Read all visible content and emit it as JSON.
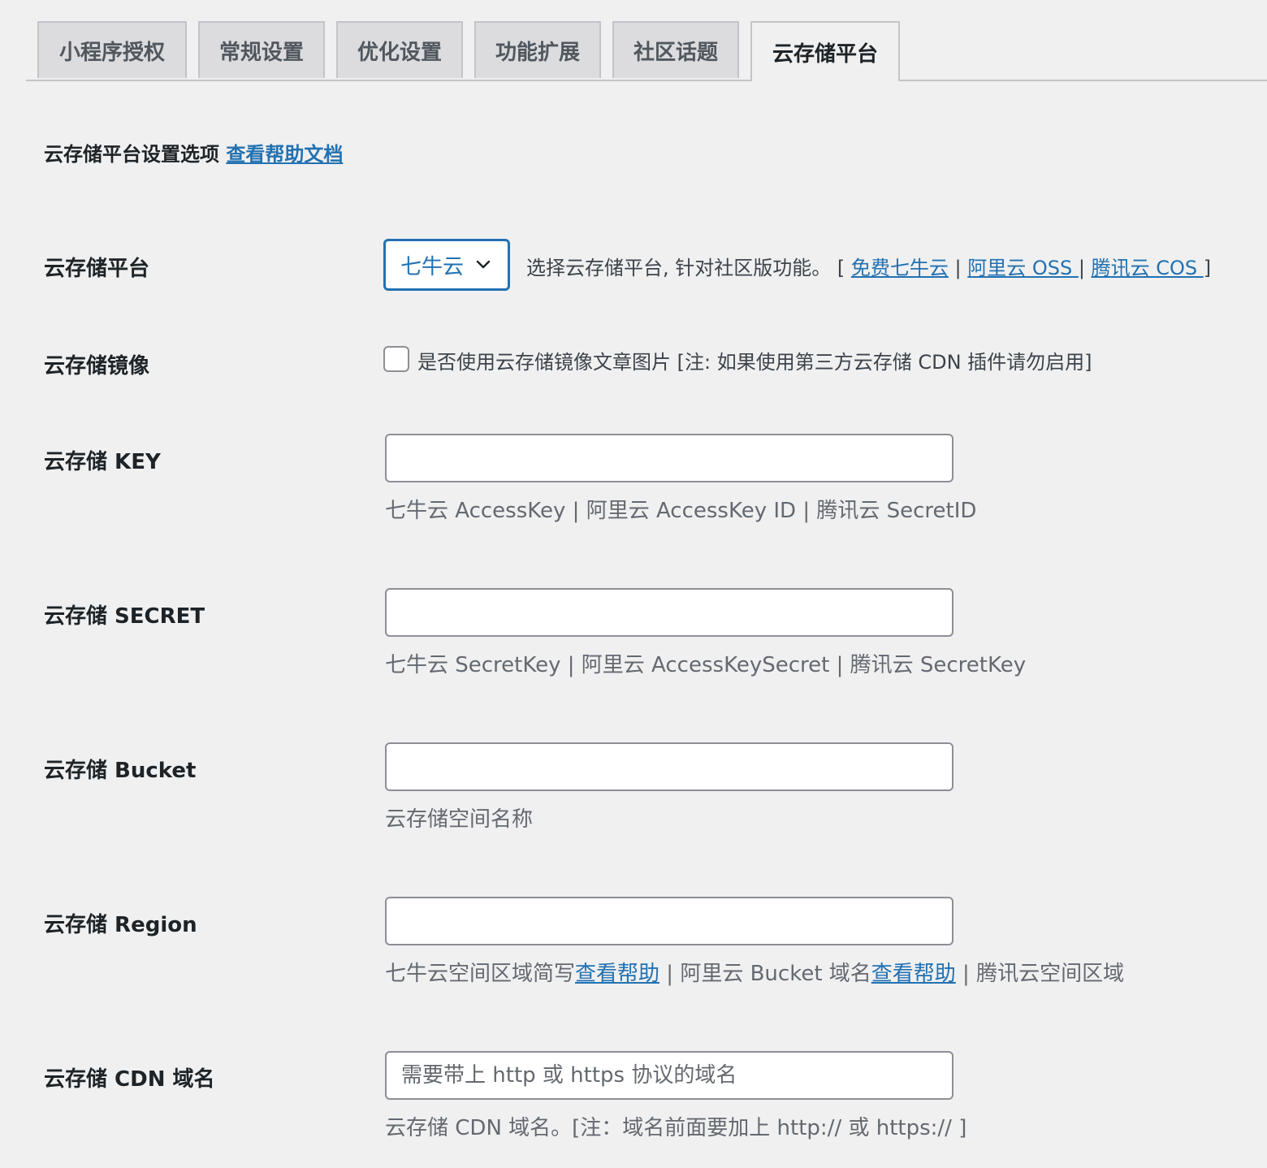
{
  "tabs": [
    {
      "label": "小程序授权"
    },
    {
      "label": "常规设置"
    },
    {
      "label": "优化设置"
    },
    {
      "label": "功能扩展"
    },
    {
      "label": "社区话题"
    },
    {
      "label": "云存储平台"
    }
  ],
  "section": {
    "title": "云存储平台设置选项",
    "help_link": "查看帮助文档"
  },
  "platform": {
    "label": "云存储平台",
    "selected": "七牛云",
    "desc_prefix": "选择云存储平台, 针对社区版功能。 [ ",
    "link_qiniu": "免费七牛云",
    "sep1": " | ",
    "link_aliyun": "阿里云 OSS ",
    "sep2": "| ",
    "link_tencent": "腾讯云 COS ",
    "desc_suffix": "]"
  },
  "mirror": {
    "label": "云存储镜像",
    "checkbox_label": "是否使用云存储镜像文章图片 [注: 如果使用第三方云存储 CDN 插件请勿启用]"
  },
  "key": {
    "label": "云存储 KEY",
    "value": "",
    "desc": "七牛云 AccessKey | 阿里云 AccessKey ID | 腾讯云 SecretID"
  },
  "secret": {
    "label": "云存储 SECRET",
    "value": "",
    "desc": "七牛云 SecretKey | 阿里云 AccessKeySecret | 腾讯云 SecretKey"
  },
  "bucket": {
    "label": "云存储 Bucket",
    "value": "",
    "desc": "云存储空间名称"
  },
  "region": {
    "label": "云存储 Region",
    "value": "",
    "desc_part1": "七牛云空间区域简写",
    "help1": "查看帮助",
    "desc_part2": " | 阿里云 Bucket 域名",
    "help2": "查看帮助",
    "desc_part3": " | 腾讯云空间区域"
  },
  "cdn": {
    "label": "云存储 CDN 域名",
    "placeholder": "需要带上 http 或 https 协议的域名",
    "desc": "云存储 CDN 域名。[注：域名前面要加上 http:// 或 https:// ]"
  }
}
